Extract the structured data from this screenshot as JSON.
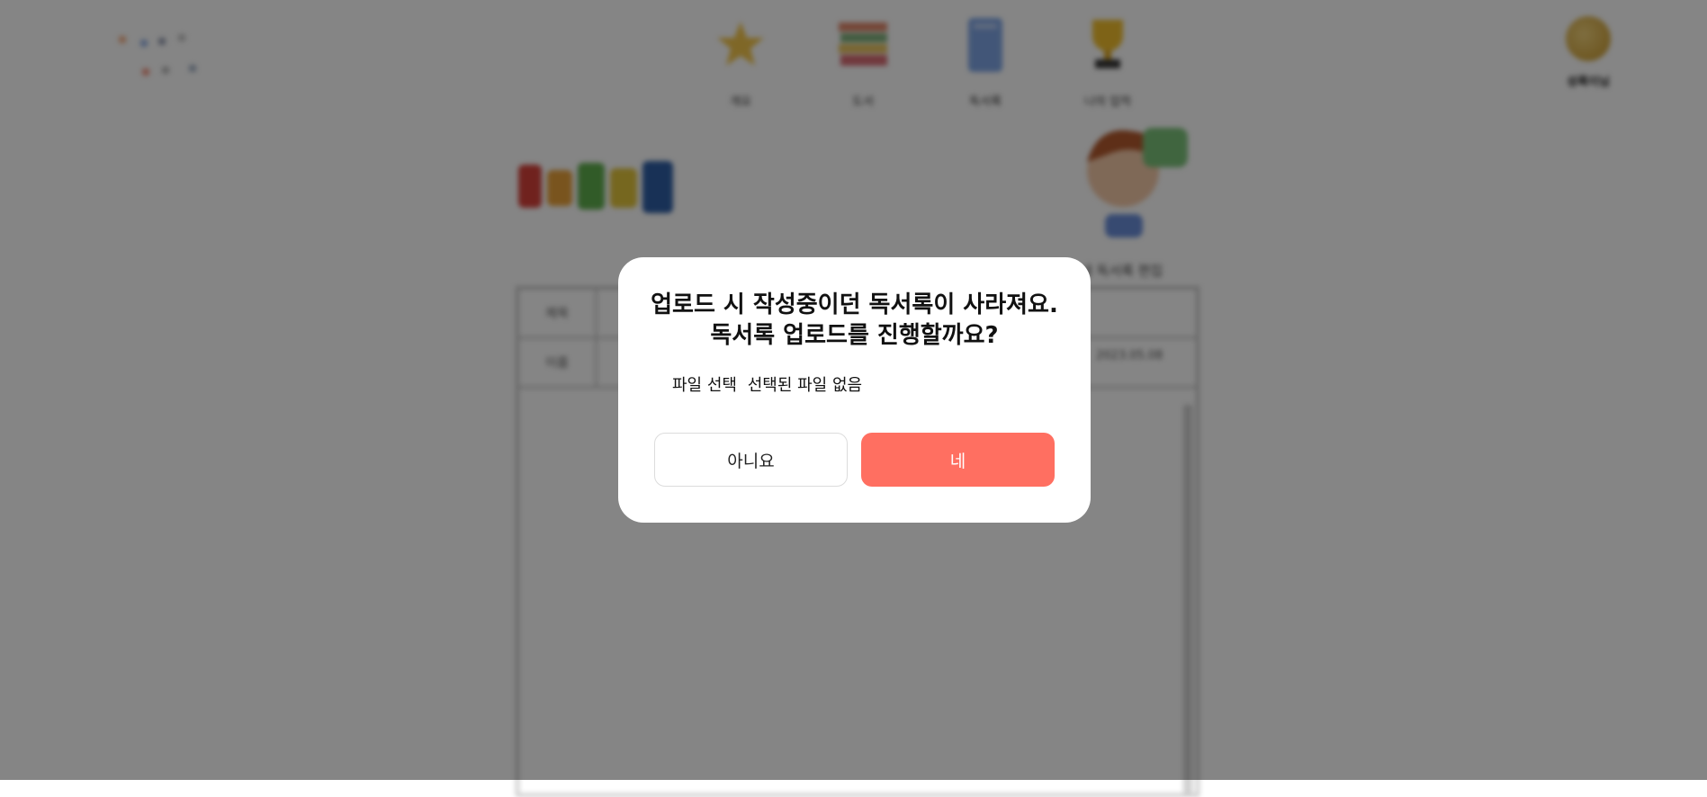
{
  "nav": {
    "items": [
      {
        "label": "개요",
        "icon": "star-icon"
      },
      {
        "label": "도서",
        "icon": "books-icon"
      },
      {
        "label": "독서록",
        "icon": "notebook-icon"
      },
      {
        "label": "나의 업적",
        "icon": "trophy-icon"
      }
    ]
  },
  "user": {
    "name": "성록이님"
  },
  "background": {
    "row1_label": "제목",
    "row2_label": "이름",
    "side_text": "내 독서록 편집",
    "date_text": "2023.05.08"
  },
  "modal": {
    "title_line1": "업로드 시 작성중이던 독서록이 사라져요.",
    "title_line2": "독서록 업로드를 진행할까요?",
    "file_button_label": "파일 선택",
    "file_status": "선택된 파일 없음",
    "no_label": "아니요",
    "yes_label": "네"
  },
  "colors": {
    "accent": "#ff6f61",
    "overlay": "rgba(0,0,0,0.48)"
  }
}
